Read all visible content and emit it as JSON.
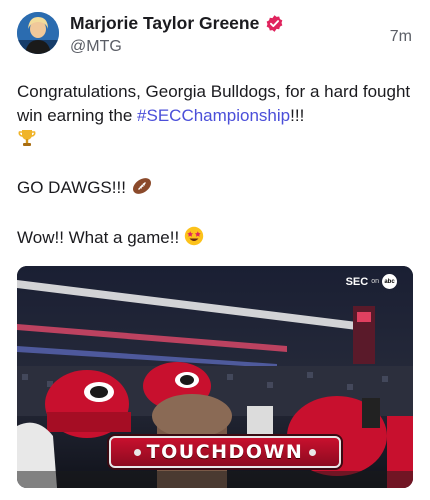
{
  "author": {
    "name": "Marjorie Taylor Greene",
    "handle": "@MTG",
    "verified_icon": "verified-badge-icon",
    "verified_color": "#e0245e"
  },
  "post": {
    "time": "7m",
    "text_line1_before": "Congratulations, Georgia Bulldogs, for a hard fought win earning the ",
    "hashtag": "#SECChampionship",
    "text_line1_after": "!!!",
    "trophy_icon": "trophy-emoji",
    "text_line2": "GO DAWGS!!!",
    "football_icon": "football-emoji",
    "text_line3": "Wow!! What a game!!",
    "starstruck_icon": "star-struck-emoji",
    "hashtag_color": "#4b4fd9"
  },
  "media": {
    "banner_text": "TOUCHDOWN",
    "network_bug": "SEC",
    "network_on": "on",
    "network_abc": "abc",
    "accent_color": "#c8102e"
  }
}
